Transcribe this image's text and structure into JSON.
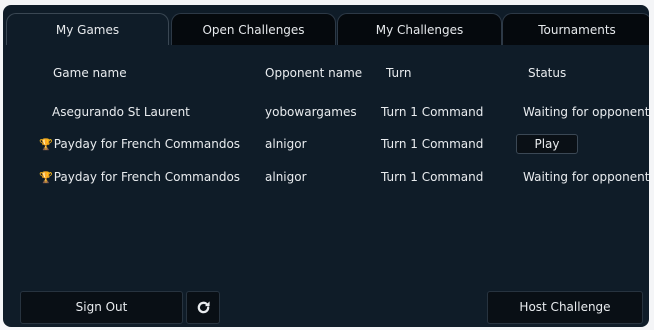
{
  "tabs": [
    {
      "label": "My Games",
      "active": true
    },
    {
      "label": "Open Challenges"
    },
    {
      "label": "My Challenges"
    },
    {
      "label": "Tournaments"
    }
  ],
  "table": {
    "headers": [
      "Game name",
      "Opponent name",
      "Turn",
      "Status"
    ],
    "rows": [
      {
        "game": "Asegurando St Laurent",
        "opponent": "yobowargames",
        "turn": "Turn 1 Command",
        "status": "Waiting for opponent...",
        "tournament": false
      },
      {
        "game": "Payday for French Commandos",
        "opponent": "alnigor",
        "turn": "Turn 1 Command",
        "action": "Play",
        "tournament": true
      },
      {
        "game": "Payday for French Commandos",
        "opponent": "alnigor",
        "turn": "Turn 1 Command",
        "status": "Waiting for opponent...",
        "tournament": true
      }
    ]
  },
  "buttons": {
    "sign_out": "Sign Out",
    "host_challenge": "Host Challenge"
  },
  "icons": {
    "trophy": "trophy-icon",
    "refresh": "refresh-icon"
  },
  "colors": {
    "panel": "#0f1c28",
    "tab_inactive": "#05090d",
    "trophy": "#e3a52e"
  }
}
